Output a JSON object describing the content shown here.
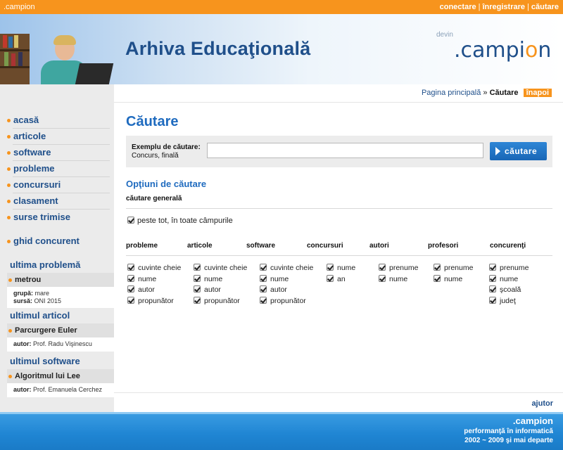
{
  "topbar": {
    "brand": ".campion",
    "links": [
      "conectare",
      "înregistrare",
      "căutare"
    ],
    "separator": "|"
  },
  "header": {
    "title": "Arhiva Educaţională",
    "devin": "devin",
    "logo_prefix": ".campi",
    "logo_o": "o",
    "logo_suffix": "n"
  },
  "breadcrumb": {
    "home": "Pagina principală",
    "sep": "»",
    "current": "Căutare",
    "back": "înapoi"
  },
  "sidebar": {
    "nav": [
      "acasă",
      "articole",
      "software",
      "probleme",
      "concursuri",
      "clasament",
      "surse trimise"
    ],
    "guide": "ghid concurent",
    "last_problem": {
      "title": "ultima problemă",
      "name": "metrou",
      "grupa_label": "grupă:",
      "grupa": "mare",
      "sursa_label": "sursă:",
      "sursa": "ONI 2015"
    },
    "last_article": {
      "title": "ultimul articol",
      "name": "Parcurgere Euler",
      "author_label": "autor:",
      "author": "Prof. Radu Vişinescu"
    },
    "last_software": {
      "title": "ultimul software",
      "name": "Algoritmul lui Lee",
      "author_label": "autor:",
      "author": "Prof. Emanuela Cerchez"
    }
  },
  "main": {
    "title": "Căutare",
    "example_label": "Exemplu de căutare:",
    "example_value": "Concurs, finală",
    "search_value": "",
    "search_button": "căutare",
    "options_title": "Opţiuni de căutare",
    "general_title": "căutare generală",
    "everywhere": "peste tot, în toate câmpurile",
    "columns": [
      {
        "head": "probleme",
        "items": [
          "cuvinte cheie",
          "nume",
          "autor",
          "propunător"
        ]
      },
      {
        "head": "articole",
        "items": [
          "cuvinte cheie",
          "nume",
          "autor",
          "propunător"
        ]
      },
      {
        "head": "software",
        "items": [
          "cuvinte cheie",
          "nume",
          "autor",
          "propunător"
        ]
      },
      {
        "head": "concursuri",
        "items": [
          "nume",
          "an"
        ]
      },
      {
        "head": "autori",
        "items": [
          "prenume",
          "nume"
        ]
      },
      {
        "head": "profesori",
        "items": [
          "prenume",
          "nume"
        ]
      },
      {
        "head": "concurenţi",
        "items": [
          "prenume",
          "nume",
          "şcoală",
          "judeţ"
        ]
      }
    ],
    "help": "ajutor"
  },
  "footer": {
    "brand": ".campion",
    "tagline": "performanţă în informatică",
    "years": "2002 ~ 2009 şi mai departe"
  },
  "colors": {
    "accent": "#f7941d",
    "brand_blue": "#1f4f8a",
    "link_blue": "#1f6bbf"
  }
}
